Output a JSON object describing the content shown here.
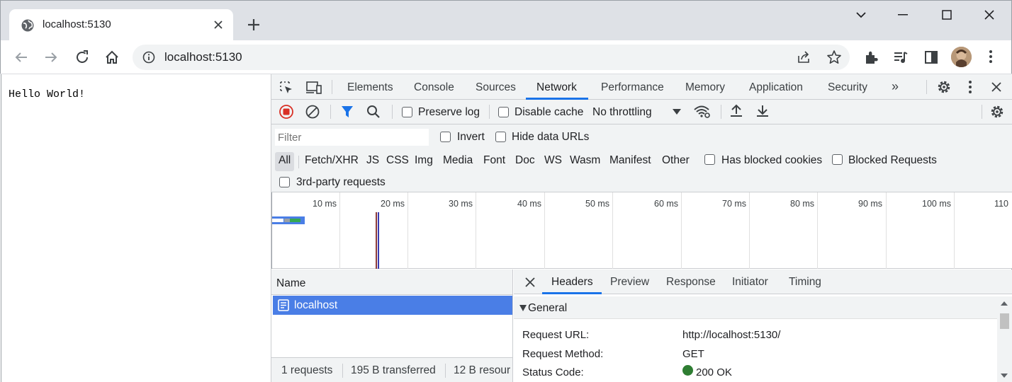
{
  "browser": {
    "tab": {
      "title": "localhost:5130",
      "icon": "globe-icon"
    },
    "address": {
      "url": "localhost:5130"
    },
    "icons": [
      "back-icon",
      "forward-icon",
      "reload-icon",
      "home-icon",
      "site-info-icon",
      "share-icon",
      "bookmark-star-icon",
      "extensions-icon",
      "media-icon",
      "side-panel-icon",
      "profile-avatar",
      "kebab-menu-icon"
    ]
  },
  "page": {
    "content": "Hello World!"
  },
  "devtools": {
    "tabs": [
      "Elements",
      "Console",
      "Sources",
      "Network",
      "Performance",
      "Memory",
      "Application",
      "Security"
    ],
    "active_tab": "Network",
    "more_tabs": "»",
    "actions": {
      "preserve_log": "Preserve log",
      "disable_cache": "Disable cache",
      "throttling": "No throttling"
    },
    "filter": {
      "placeholder": "Filter",
      "invert": "Invert",
      "hide_data_urls": "Hide data URLs",
      "types": [
        "All",
        "Fetch/XHR",
        "JS",
        "CSS",
        "Img",
        "Media",
        "Font",
        "Doc",
        "WS",
        "Wasm",
        "Manifest",
        "Other"
      ],
      "has_blocked_cookies": "Has blocked cookies",
      "blocked_requests": "Blocked Requests",
      "third_party": "3rd-party requests"
    },
    "overview": {
      "ticks": [
        "10 ms",
        "20 ms",
        "30 ms",
        "40 ms",
        "50 ms",
        "60 ms",
        "70 ms",
        "80 ms",
        "90 ms",
        "100 ms",
        "110"
      ]
    },
    "requests": {
      "column": "Name",
      "rows": [
        {
          "name": "localhost"
        }
      ],
      "status": {
        "requests": "1 requests",
        "transferred": "195 B transferred",
        "resources": "12 B resour"
      }
    },
    "details": {
      "tabs": [
        "Headers",
        "Preview",
        "Response",
        "Initiator",
        "Timing"
      ],
      "active_tab": "Headers",
      "section": "General",
      "fields": [
        {
          "key": "Request URL:",
          "value": "http://localhost:5130/"
        },
        {
          "key": "Request Method:",
          "value": "GET"
        },
        {
          "key": "Status Code:",
          "value": "200 OK"
        }
      ],
      "status_color": "#2e7d32"
    },
    "colors": {
      "accent": "#1a73e8",
      "selected_row": "#4a7ee6",
      "record": "#d93025"
    }
  }
}
